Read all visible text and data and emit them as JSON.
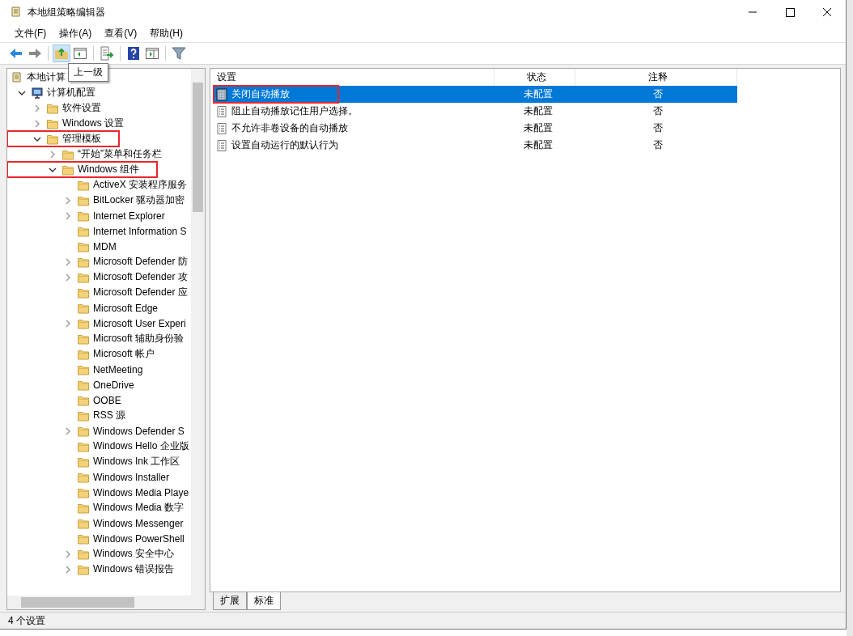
{
  "window": {
    "title": "本地组策略编辑器"
  },
  "menu": [
    "文件(F)",
    "操作(A)",
    "查看(V)",
    "帮助(H)"
  ],
  "toolbar": {
    "tooltip": "上一级"
  },
  "tree": [
    {
      "label": "本地计算",
      "kind": "policy",
      "children": [
        {
          "label": "计算机配置",
          "kind": "computer",
          "expanded": true,
          "children": [
            {
              "label": "软件设置",
              "kind": "folder",
              "expanded": false
            },
            {
              "label": "Windows 设置",
              "kind": "folder",
              "expanded": false
            },
            {
              "label": "管理模板",
              "kind": "folder",
              "expanded": true,
              "highlighted": true,
              "children": [
                {
                  "label": "“开始”菜单和任务栏",
                  "kind": "folder",
                  "expanded": false
                },
                {
                  "label": "Windows 组件",
                  "kind": "folder",
                  "expanded": true,
                  "highlighted": true,
                  "children": [
                    {
                      "label": "ActiveX 安装程序服务",
                      "kind": "folder"
                    },
                    {
                      "label": "BitLocker 驱动器加密",
                      "kind": "folder",
                      "expanded": false
                    },
                    {
                      "label": "Internet Explorer",
                      "kind": "folder",
                      "expanded": false
                    },
                    {
                      "label": "Internet Information S",
                      "kind": "folder"
                    },
                    {
                      "label": "MDM",
                      "kind": "folder"
                    },
                    {
                      "label": "Microsoft Defender 防",
                      "kind": "folder",
                      "expanded": false
                    },
                    {
                      "label": "Microsoft Defender 攻",
                      "kind": "folder",
                      "expanded": false
                    },
                    {
                      "label": "Microsoft Defender 应",
                      "kind": "folder"
                    },
                    {
                      "label": "Microsoft Edge",
                      "kind": "folder"
                    },
                    {
                      "label": "Microsoft User Experi",
                      "kind": "folder",
                      "expanded": false
                    },
                    {
                      "label": "Microsoft 辅助身份验",
                      "kind": "folder"
                    },
                    {
                      "label": "Microsoft 帐户",
                      "kind": "folder"
                    },
                    {
                      "label": "NetMeeting",
                      "kind": "folder"
                    },
                    {
                      "label": "OneDrive",
                      "kind": "folder"
                    },
                    {
                      "label": "OOBE",
                      "kind": "folder"
                    },
                    {
                      "label": "RSS 源",
                      "kind": "folder"
                    },
                    {
                      "label": "Windows Defender S",
                      "kind": "folder",
                      "expanded": false
                    },
                    {
                      "label": "Windows Hello 企业版",
                      "kind": "folder"
                    },
                    {
                      "label": "Windows Ink 工作区",
                      "kind": "folder"
                    },
                    {
                      "label": "Windows Installer",
                      "kind": "folder"
                    },
                    {
                      "label": "Windows Media Playe",
                      "kind": "folder"
                    },
                    {
                      "label": "Windows Media 数字",
                      "kind": "folder"
                    },
                    {
                      "label": "Windows Messenger",
                      "kind": "folder"
                    },
                    {
                      "label": "Windows PowerShell",
                      "kind": "folder"
                    },
                    {
                      "label": "Windows 安全中心",
                      "kind": "folder",
                      "expanded": false
                    },
                    {
                      "label": "Windows 错误报告",
                      "kind": "folder",
                      "expanded": false
                    }
                  ]
                }
              ]
            }
          ]
        }
      ]
    }
  ],
  "table": {
    "columns": [
      "设置",
      "状态",
      "注释"
    ],
    "rows": [
      {
        "cells": [
          "关闭自动播放",
          "未配置",
          "否"
        ],
        "selected": true,
        "highlighted": true
      },
      {
        "cells": [
          "阻止自动播放记住用户选择。",
          "未配置",
          "否"
        ],
        "selected": false,
        "highlighted": false
      },
      {
        "cells": [
          "不允许非卷设备的自动播放",
          "未配置",
          "否"
        ],
        "selected": false,
        "highlighted": false
      },
      {
        "cells": [
          "设置自动运行的默认行为",
          "未配置",
          "否"
        ],
        "selected": false,
        "highlighted": false
      }
    ]
  },
  "view_tabs": [
    {
      "label": "扩展",
      "selected": false
    },
    {
      "label": "标准",
      "selected": true
    }
  ],
  "status_bar": "4 个设置"
}
